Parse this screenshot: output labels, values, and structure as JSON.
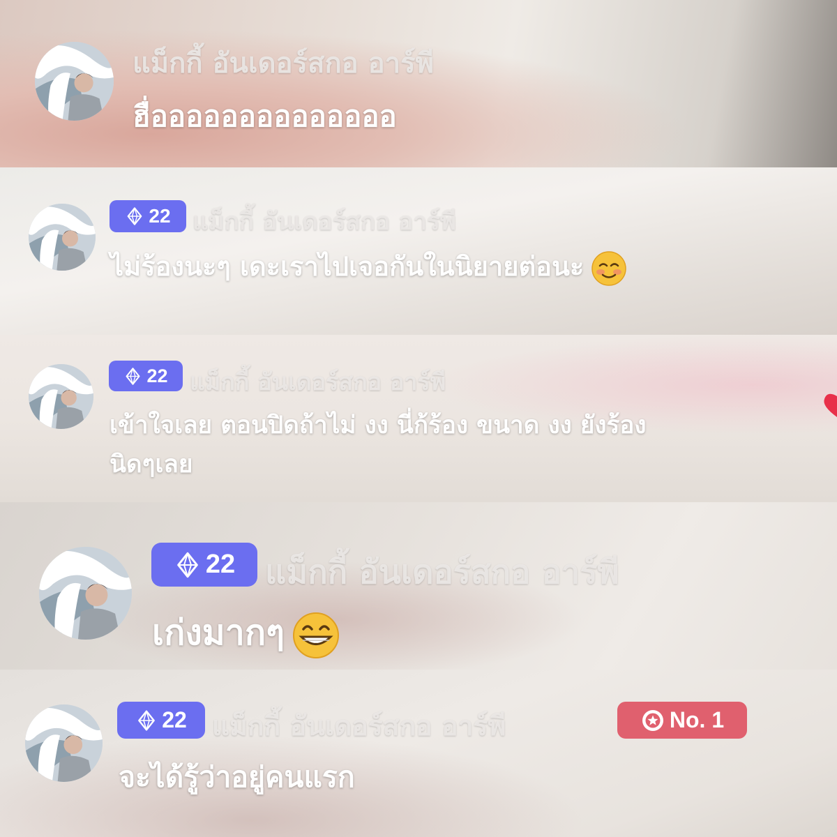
{
  "colors": {
    "level_badge": "#6b6ef0",
    "rank_badge": "#e0606e",
    "username": "#ece8e4",
    "message": "#ffffff"
  },
  "comments": [
    {
      "username": "แม็กกี้ อันเดอร์สกอ อาร์พี",
      "message": "ฮื่ออออออออออออออ"
    },
    {
      "level": "22",
      "username": "แม็กกี้ อันเดอร์สกอ อาร์พี",
      "message": "ไม่ร้องนะๆ เดะเราไปเจอกันในนิยายต่อนะ",
      "emoji": "smiling-blush-emoji"
    },
    {
      "level": "22",
      "username": "แม็กกี้ อันเดอร์สกอ อาร์พี",
      "message_line1": "เข้าใจเลย ตอนปิดถ้าไม่ งง นี่ก้ร้อง ขนาด งง ยังร้อง",
      "message_line2": "นิดๆเลย"
    },
    {
      "level": "22",
      "username": "แม็กกี้ อันเดอร์สกอ อาร์พี",
      "message": "เก่งมากๆ",
      "emoji": "grinning-emoji"
    },
    {
      "level": "22",
      "username": "แม็กกี้ อันเดอร์สกอ อาร์พี",
      "rank": "No. 1",
      "message": "จะได้รู้ว่าอยู่คนแรก"
    }
  ]
}
